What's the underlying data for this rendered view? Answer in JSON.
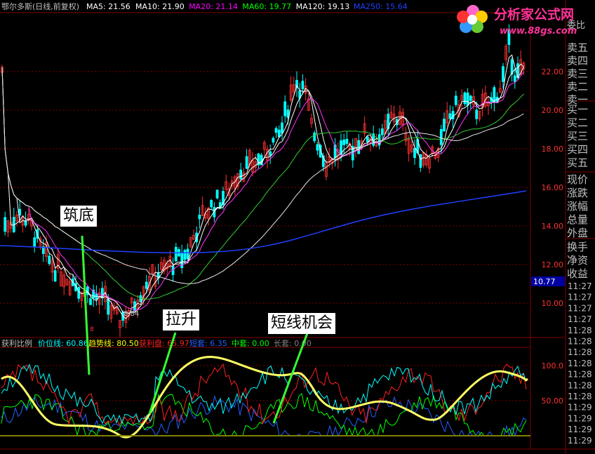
{
  "main_header": {
    "stock_title": "鄂尔多斯(日线,前复权)",
    "indicators": [
      {
        "label": "MA5",
        "value": "21.56",
        "color": "#ffffff"
      },
      {
        "label": "MA10",
        "value": "21.90",
        "color": "#ffffff"
      },
      {
        "label": "MA20",
        "value": "21.14",
        "color": "#ff00ff"
      },
      {
        "label": "MA60",
        "value": "19.77",
        "color": "#00ff00"
      },
      {
        "label": "MA120",
        "value": "19.13",
        "color": "#ffffff"
      },
      {
        "label": "MA250",
        "value": "15.64",
        "color": "#2040ff"
      }
    ]
  },
  "sub_header": {
    "title": "获利比例",
    "items": [
      {
        "label": "价位线",
        "value": "60.86",
        "color": "#00ffff"
      },
      {
        "label": "趋势线",
        "value": "80.50",
        "color": "#ffff00"
      },
      {
        "label": "获利盘",
        "value": "65.97",
        "color": "#ff2020"
      },
      {
        "label": "短套",
        "value": "6.35",
        "color": "#2060ff"
      },
      {
        "label": "中套",
        "value": "0.00",
        "color": "#00ff00"
      },
      {
        "label": "长套",
        "value": "0.00",
        "color": "#808080"
      }
    ]
  },
  "price_axis": [
    "22.00",
    "20.00",
    "18.00",
    "16.00",
    "14.00",
    "12.00",
    "10.00"
  ],
  "current_price": "10.77",
  "low_marker": "8.84",
  "sub_axis": [
    "100.0",
    "50.00"
  ],
  "panel_top_labels": [
    "卖五",
    "卖四",
    "卖三",
    "卖二",
    "卖一"
  ],
  "panel_buy_labels": [
    "买一",
    "买二",
    "买三",
    "买四",
    "买五"
  ],
  "panel_info_labels": [
    "现价",
    "涨跌",
    "涨幅",
    "总量",
    "外盘"
  ],
  "panel_info2_labels": [
    "换手",
    "净资",
    "收益"
  ],
  "panel_truncated_top": "委比",
  "time_ticks": [
    "11:27",
    "11:27",
    "11:27",
    "11:27",
    "11:28",
    "11:28",
    "11:28",
    "11:28",
    "11:28",
    "11:28",
    "11:28",
    "11:29",
    "11:29",
    "11:29",
    "11:29"
  ],
  "annotations": {
    "bottom": "筑底",
    "rise": "拉升",
    "opportunity": "短线机会"
  },
  "logo": {
    "title": "分析家公式网",
    "url": "www.88gs.com"
  },
  "colors": {
    "bg": "#000000",
    "grid": "#800000",
    "up": "#ff3030",
    "down": "#00ffff"
  }
}
